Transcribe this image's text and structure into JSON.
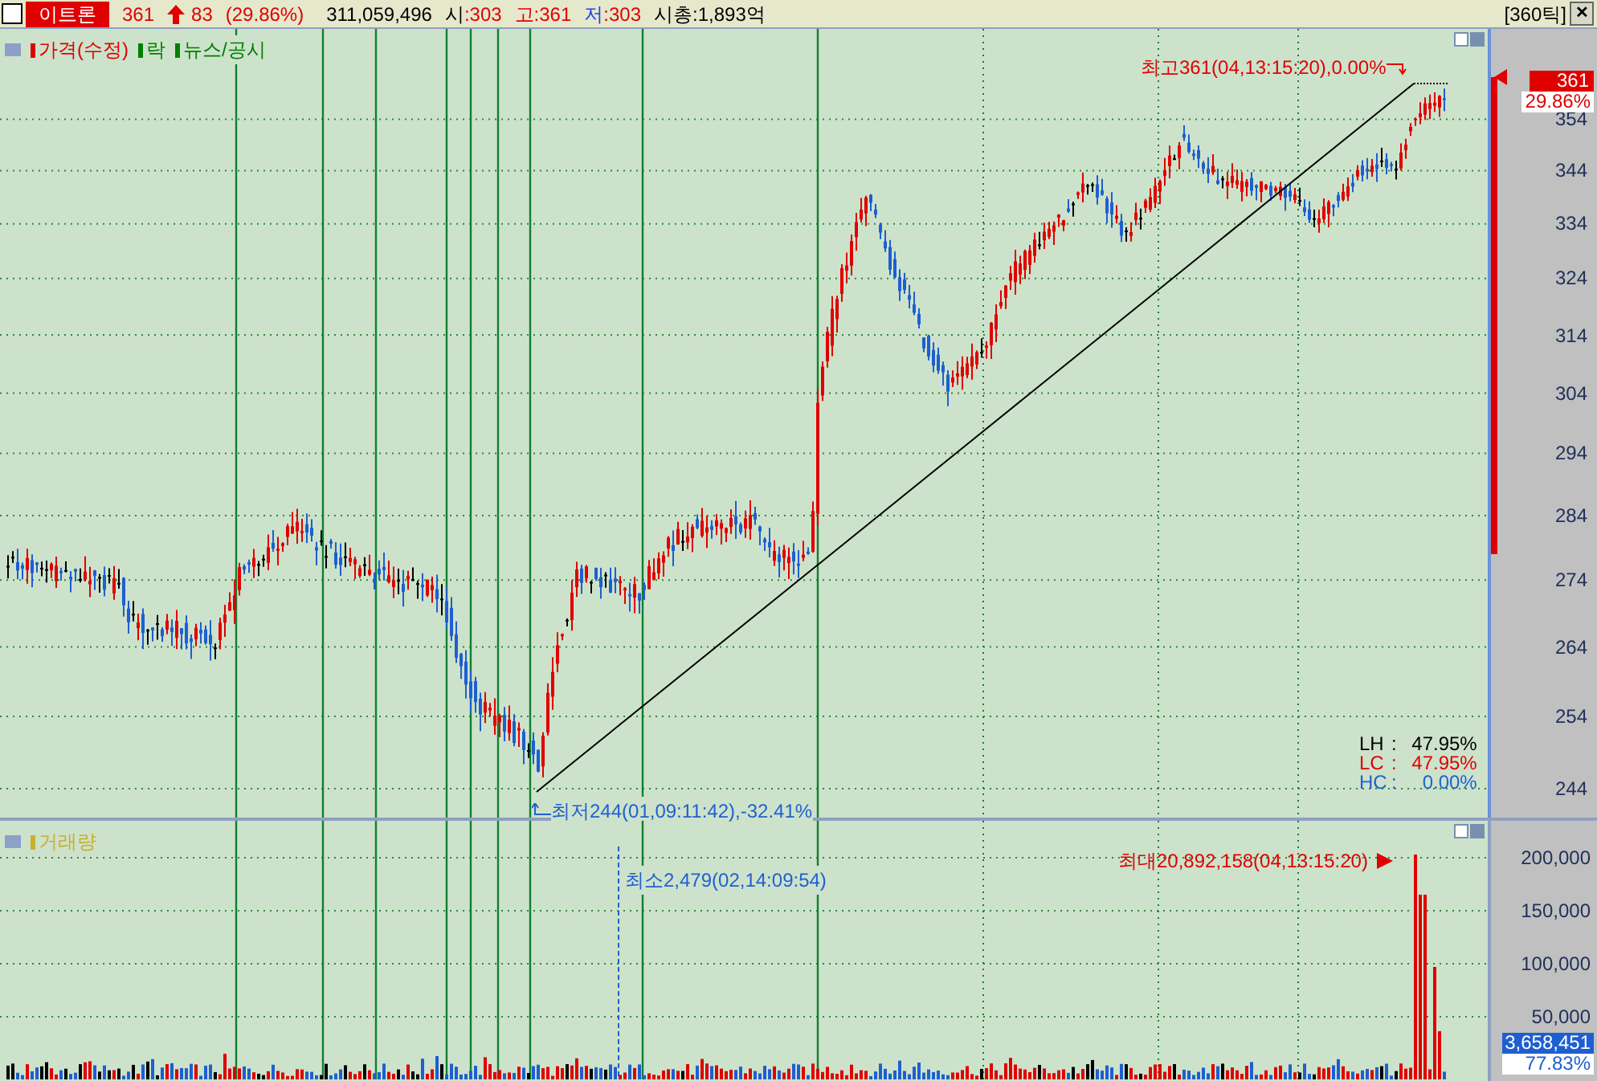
{
  "header": {
    "checked": false,
    "stock_name": "이트론",
    "price": "361",
    "change": "83",
    "change_pct": "(29.86%)",
    "volume": "311,059,496",
    "open_label": "시",
    "open": ":303",
    "high_label": "고",
    "high": ":361",
    "low_label": "저",
    "low": ":303",
    "market_cap": "시총:1,893억",
    "period": "[360틱]",
    "close": "✕"
  },
  "price_panel": {
    "legend": [
      {
        "label": "가격(수정)",
        "color": "#e00000"
      },
      {
        "label": "락",
        "color": "#008000"
      },
      {
        "label": "뉴스/공시",
        "color": "#008000"
      }
    ],
    "axis": [
      "354",
      "344",
      "334",
      "324",
      "314",
      "304",
      "294",
      "284",
      "274",
      "264",
      "254",
      "244"
    ],
    "current": {
      "price": "361",
      "pct": "29.86%"
    },
    "annotations": [
      {
        "kind": "high",
        "text": "최고361(04,13:15:20),0.00%"
      },
      {
        "kind": "low",
        "text": "최저244(01,09:11:42),-32.41%"
      }
    ],
    "ratios": [
      {
        "label": "LH",
        "sep": ":",
        "value": "47.95%",
        "color": "#000000"
      },
      {
        "label": "LC",
        "sep": ":",
        "value": "47.95%",
        "color": "#e00000"
      },
      {
        "label": "HC",
        "sep": ":",
        "value": "0.00%",
        "color": "#2060d0"
      }
    ]
  },
  "volume_panel": {
    "legend": [
      {
        "label": "거래량",
        "color": "#c8b030"
      }
    ],
    "axis": [
      "200,000",
      "150,000",
      "100,000",
      "50,000"
    ],
    "current": {
      "volume": "3,658,451",
      "pct": "77.83%"
    },
    "annotations": [
      {
        "kind": "max",
        "text": "최대20,892,158(04,13:15:20)"
      },
      {
        "kind": "min",
        "text": "최소2,479(02,14:09:54)"
      }
    ]
  }
}
